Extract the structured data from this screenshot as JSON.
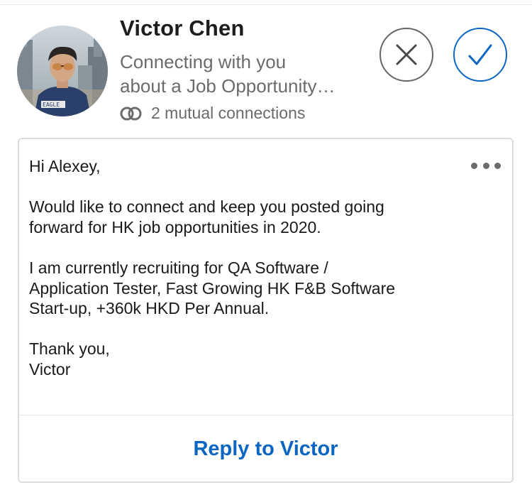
{
  "invitation": {
    "sender_name": "Victor Chen",
    "headline_lines": [
      "Connecting with you",
      "about a Job Opportunity…"
    ],
    "mutual_connections": "2 mutual connections",
    "avatar_shirt_text": "EAGLE"
  },
  "actions": {
    "ignore_icon": "close-icon",
    "accept_icon": "checkmark-icon"
  },
  "message": {
    "lines": [
      "Hi Alexey,",
      "",
      "Would like to connect and keep you posted going",
      "forward for HK job opportunities in 2020.",
      "",
      "I am currently recruiting for QA Software /",
      "Application Tester, Fast Growing HK F&B Software",
      "Start-up, +360k HKD Per Annual.",
      "",
      "Thank you,",
      "Victor"
    ],
    "more_icon": "more-horizontal-icon",
    "reply_label": "Reply to Victor"
  },
  "colors": {
    "accent": "#0a66c2",
    "secondary_text": "#6b6b6b",
    "primary_text": "#1a1a1a"
  }
}
